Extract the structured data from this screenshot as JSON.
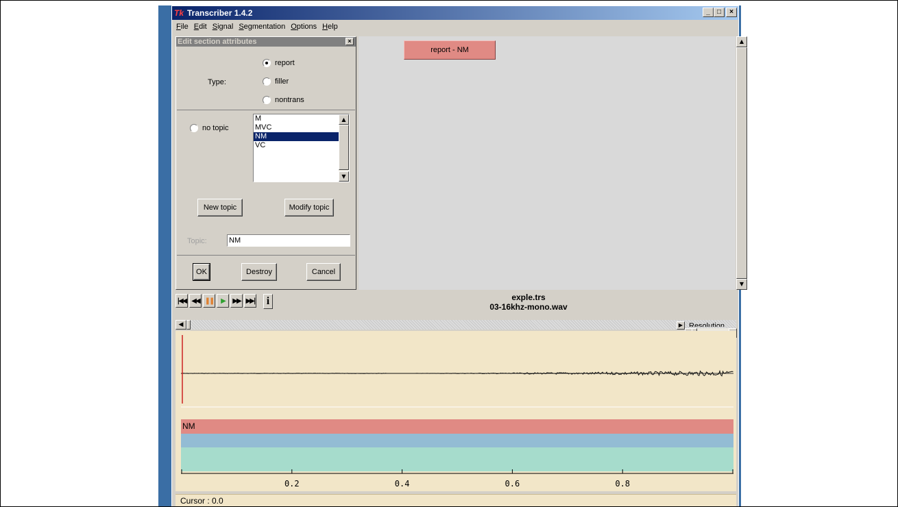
{
  "window": {
    "title": "Transcriber 1.4.2",
    "app_icon": "Tk",
    "buttons": {
      "minimize": "_",
      "maximize": "□",
      "close": "×"
    }
  },
  "menu": [
    {
      "label": "File",
      "u": "F",
      "rest": "ile"
    },
    {
      "label": "Edit",
      "u": "E",
      "rest": "dit"
    },
    {
      "label": "Signal",
      "u": "S",
      "rest": "ignal"
    },
    {
      "label": "Segmentation",
      "u": "S",
      "rest": "egmentation"
    },
    {
      "label": "Options",
      "u": "O",
      "rest": "ptions"
    },
    {
      "label": "Help",
      "u": "H",
      "rest": "elp"
    }
  ],
  "dialog": {
    "title": "Edit section attributes",
    "close_glyph": "×",
    "type_label": "Type:",
    "type_options": [
      {
        "label": "report",
        "selected": true
      },
      {
        "label": "filler",
        "selected": false
      },
      {
        "label": "nontrans",
        "selected": false
      }
    ],
    "no_topic_label": "no topic",
    "topics": [
      {
        "label": "M",
        "selected": false
      },
      {
        "label": "MVC",
        "selected": false
      },
      {
        "label": "NM",
        "selected": true
      },
      {
        "label": "VC",
        "selected": false
      }
    ],
    "new_topic_label": "New topic",
    "modify_topic_label": "Modify topic",
    "topic_field_label": "Topic:",
    "topic_value": "NM",
    "ok_label": "OK",
    "destroy_label": "Destroy",
    "cancel_label": "Cancel"
  },
  "section_button": "report - NM",
  "player": {
    "transcript_file": "exple.trs",
    "audio_file": "03-16khz-mono.wav",
    "info_glyph": "i"
  },
  "resolution_label": "Resolution",
  "tiers": {
    "topic": "NM",
    "colors": {
      "topic": "#e08a84",
      "speaker": "#93bcd4",
      "segment": "#a6dccc"
    }
  },
  "axis": {
    "ticks": [
      "0.2",
      "0.4",
      "0.6",
      "0.8"
    ],
    "tick_values": [
      0.2,
      0.4,
      0.6,
      0.8
    ],
    "min": 0,
    "max": 1
  },
  "cursor": {
    "text": "Cursor : 0.0"
  }
}
